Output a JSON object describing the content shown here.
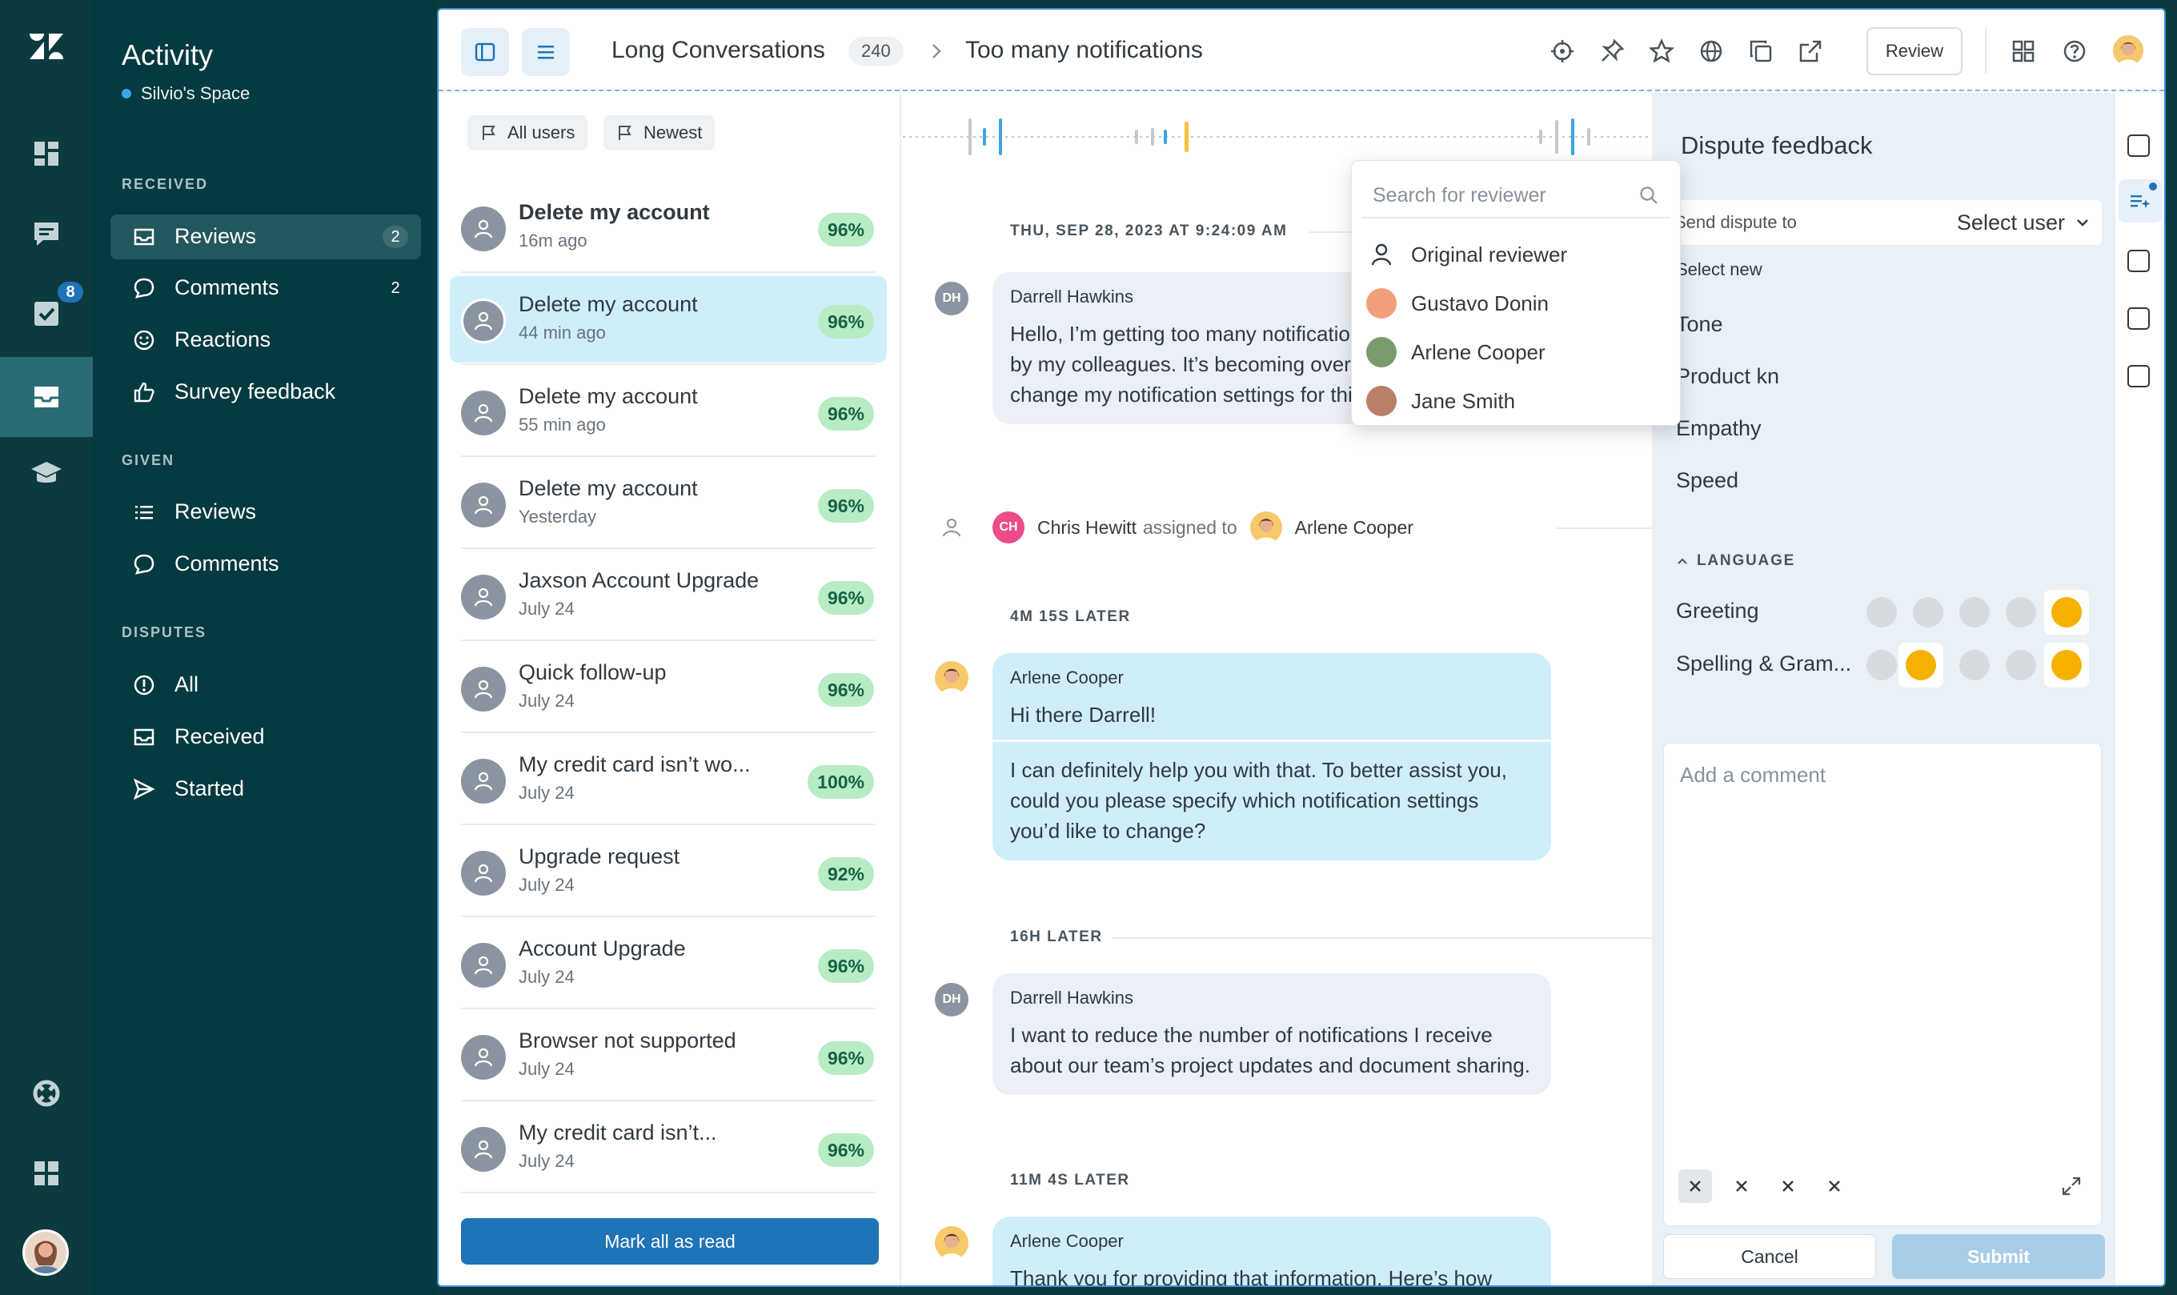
{
  "rail": {
    "items": [
      {
        "icon": "zendesk-logo"
      },
      {
        "icon": "dashboard-icon"
      },
      {
        "icon": "conversations-icon"
      },
      {
        "icon": "tasks-icon",
        "badge": "8"
      },
      {
        "icon": "inbox-icon",
        "active": true
      },
      {
        "icon": "graduation-cap-icon"
      },
      {
        "icon": "help-lifebuoy-icon"
      },
      {
        "icon": "apps-grid-icon"
      }
    ],
    "tasks_badge": "8"
  },
  "nav": {
    "title": "Activity",
    "space": "Silvio's Space",
    "received_label": "RECEIVED",
    "received": [
      {
        "label": "Reviews",
        "count": "2",
        "icon": "inbox-icon"
      },
      {
        "label": "Comments",
        "count": "2",
        "icon": "comment-icon"
      },
      {
        "label": "Reactions",
        "icon": "smile-icon"
      },
      {
        "label": "Survey feedback",
        "icon": "thumbs-up-icon"
      }
    ],
    "given_label": "GIVEN",
    "given": [
      {
        "label": "Reviews",
        "icon": "list-icon"
      },
      {
        "label": "Comments",
        "icon": "comment-icon"
      }
    ],
    "disputes_label": "DISPUTES",
    "disputes": [
      {
        "label": "All",
        "icon": "alert-circle-icon"
      },
      {
        "label": "Received",
        "icon": "inbox-icon"
      },
      {
        "label": "Started",
        "icon": "send-icon"
      }
    ]
  },
  "topbar": {
    "breadcrumb_parent": "Long Conversations",
    "breadcrumb_count": "240",
    "breadcrumb_current": "Too many notifications",
    "review_label": "Review"
  },
  "list": {
    "filters": [
      "All users",
      "Newest"
    ],
    "items": [
      {
        "title": "Delete my account",
        "sub": "16m ago",
        "pct": "96%"
      },
      {
        "title": "Delete my account",
        "sub": "44 min ago",
        "pct": "96%"
      },
      {
        "title": "Delete my account",
        "sub": "55 min ago",
        "pct": "96%"
      },
      {
        "title": "Delete my account",
        "sub": "Yesterday",
        "pct": "96%"
      },
      {
        "title": "Jaxson Account Upgrade",
        "sub": "July 24",
        "pct": "96%"
      },
      {
        "title": "Quick follow-up",
        "sub": "July 24",
        "pct": "96%"
      },
      {
        "title": "My credit card isn’t wo...",
        "sub": "July 24",
        "pct": "100%"
      },
      {
        "title": "Upgrade request",
        "sub": "July 24",
        "pct": "92%"
      },
      {
        "title": "Account Upgrade",
        "sub": "July 24",
        "pct": "96%"
      },
      {
        "title": "Browser not supported",
        "sub": "July 24",
        "pct": "96%"
      },
      {
        "title": "My credit card isn’t...",
        "sub": "July 24",
        "pct": "96%"
      }
    ],
    "mark_all": "Mark all as read"
  },
  "conversation": {
    "timestamp1": "THU, SEP 28, 2023 AT 9:24:09 AM",
    "msg1": {
      "initials": "DH",
      "author": "Darrell Hawkins",
      "text": "Hello, I’m getting too many notifications about activities by my colleagues. It’s becoming overwhelming. Can I change my notification settings for this?"
    },
    "assign": {
      "initials": "CH",
      "actor": "Chris Hewitt",
      "verb": "assigned to",
      "target": "Arlene Cooper"
    },
    "timestamp2": "4M 15S LATER",
    "msg2": {
      "author": "Arlene Cooper",
      "text1": "Hi there Darrell!",
      "text2": "I can definitely help you with that. To better assist you, could you please specify which notification settings you’d like to change?"
    },
    "timestamp3": "16H LATER",
    "msg3": {
      "initials": "DH",
      "author": "Darrell Hawkins",
      "text": "I want to reduce the number of notifications I receive about our team’s project updates and document sharing."
    },
    "timestamp4": "11M 4S LATER",
    "msg4": {
      "author": "Arlene Cooper",
      "text": "Thank you for providing that information. Here’s how"
    }
  },
  "dispute": {
    "title": "Dispute feedback",
    "send_to_label": "Send dispute to",
    "select_user": "Select user",
    "select_new": "Select new",
    "categories": [
      "Tone",
      "Product kn",
      "Empathy",
      "Speed"
    ],
    "search_placeholder": "Search for reviewer",
    "reviewers": [
      "Original reviewer",
      "Gustavo Donin",
      "Arlene Cooper",
      "Jane Smith"
    ],
    "language_label": "LANGUAGE",
    "greeting": "Greeting",
    "spelling": "Spelling & Gram...",
    "comment_placeholder": "Add a comment",
    "cancel": "Cancel",
    "submit": "Submit"
  },
  "colors": {
    "accent": "#1f73b7",
    "rail_bg": "#0b3a3f",
    "score_bg": "#b7ecc5",
    "selected_row": "#cfeefa"
  }
}
